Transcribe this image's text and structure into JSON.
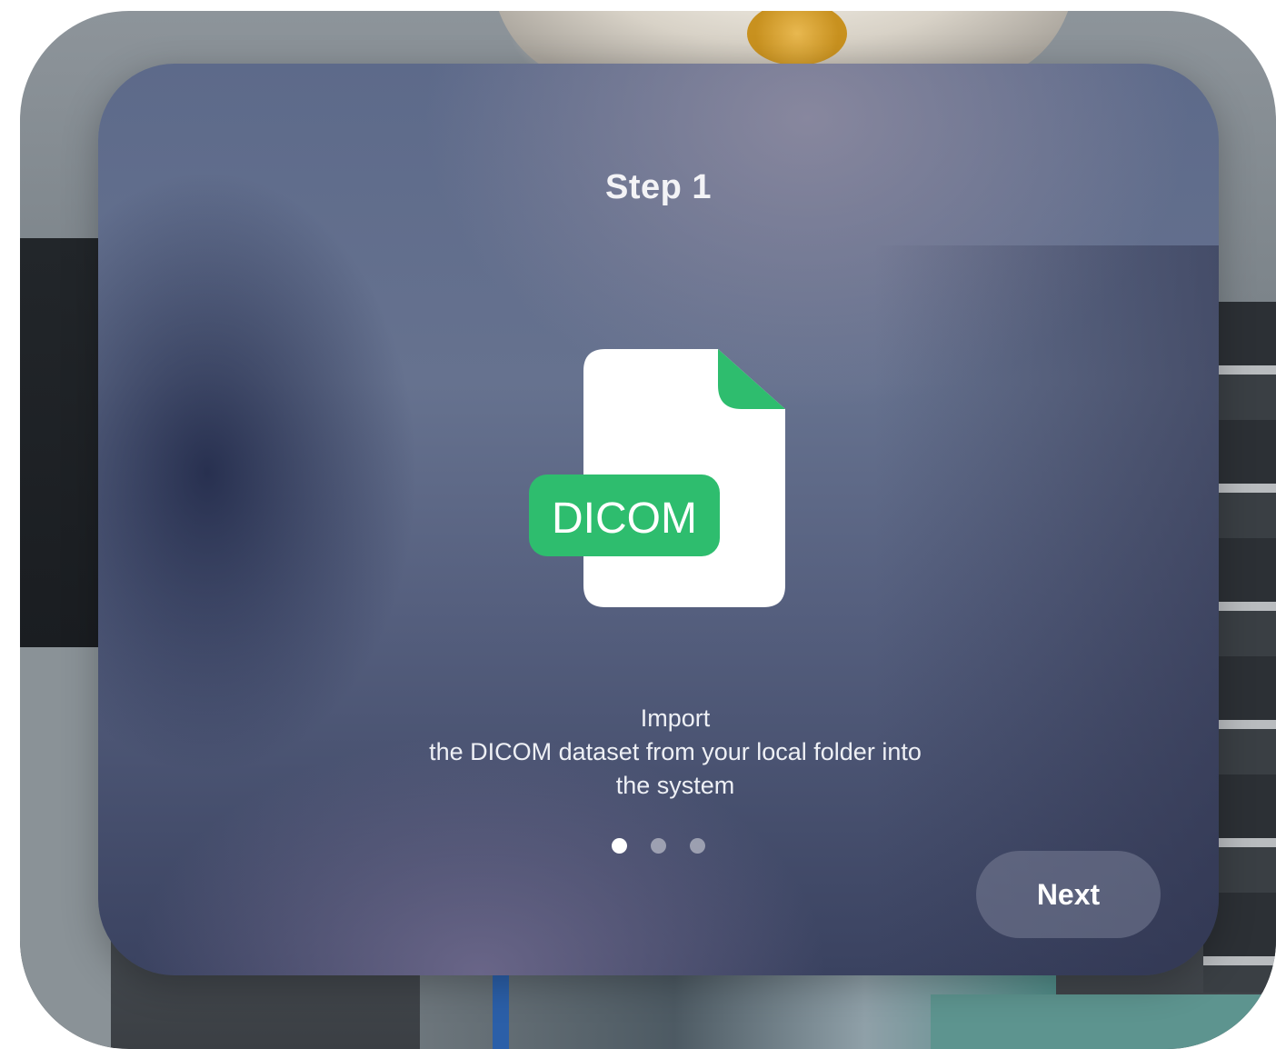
{
  "colors": {
    "accent_green": "#2ebd6e",
    "file_white": "#ffffff"
  },
  "onboarding": {
    "title": "Step 1",
    "icon": "dicom-file-icon",
    "icon_label": "DICOM",
    "description_lines": [
      "Import",
      "the DICOM dataset from your local folder into",
      "the system"
    ],
    "pagination": {
      "current": 1,
      "total": 3
    },
    "next_label": "Next"
  }
}
